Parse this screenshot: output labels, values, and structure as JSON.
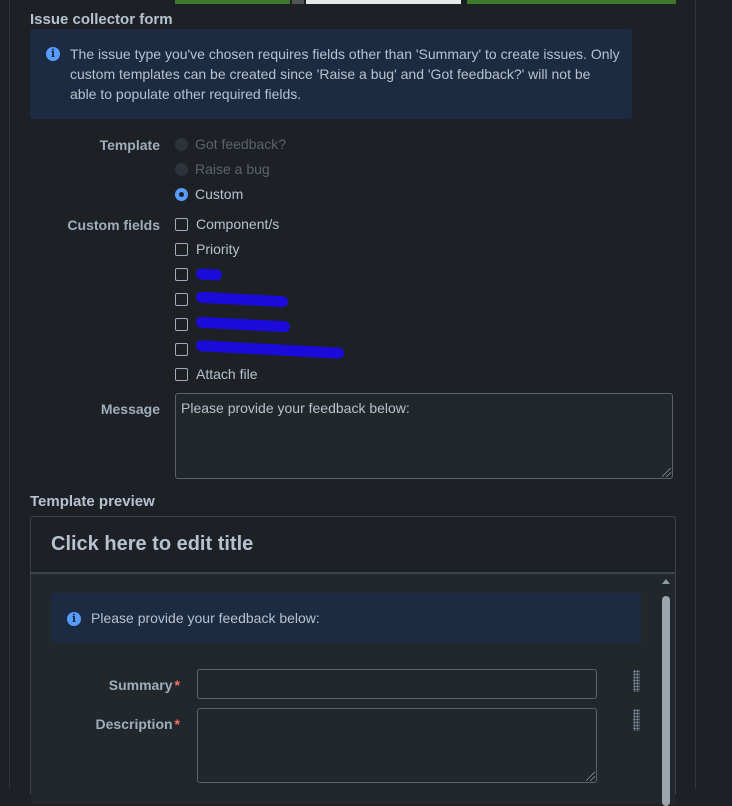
{
  "form": {
    "title": "Issue collector form",
    "info_banner": "The issue type you've chosen requires fields other than 'Summary' to create issues. Only custom templates can be created since 'Raise a bug' and 'Got feedback?' will not be able to populate other required fields.",
    "template": {
      "label": "Template",
      "options": [
        {
          "label": "Got feedback?",
          "state": "disabled"
        },
        {
          "label": "Raise a bug",
          "state": "disabled"
        },
        {
          "label": "Custom",
          "state": "selected"
        }
      ]
    },
    "custom_fields": {
      "label": "Custom fields",
      "options": [
        {
          "label": "Component/s",
          "checked": false
        },
        {
          "label": "Priority",
          "checked": false
        },
        {
          "label": "[redacted]",
          "checked": false
        },
        {
          "label": "[redacted]",
          "checked": false
        },
        {
          "label": "[redacted]",
          "checked": false
        },
        {
          "label": "[redacted]",
          "checked": false
        },
        {
          "label": "Attach file",
          "checked": false
        }
      ]
    },
    "message": {
      "label": "Message",
      "value": "Please provide your feedback below:"
    }
  },
  "preview": {
    "title": "Template preview",
    "edit_title": "Click here to edit title",
    "banner": "Please provide your feedback below:",
    "fields": [
      {
        "label": "Summary",
        "required": "*"
      },
      {
        "label": "Description",
        "required": "*"
      }
    ]
  },
  "colors": {
    "accent": "#579dff",
    "background": "#1d2125",
    "banner": "#1c2b41",
    "required": "#f87168"
  }
}
